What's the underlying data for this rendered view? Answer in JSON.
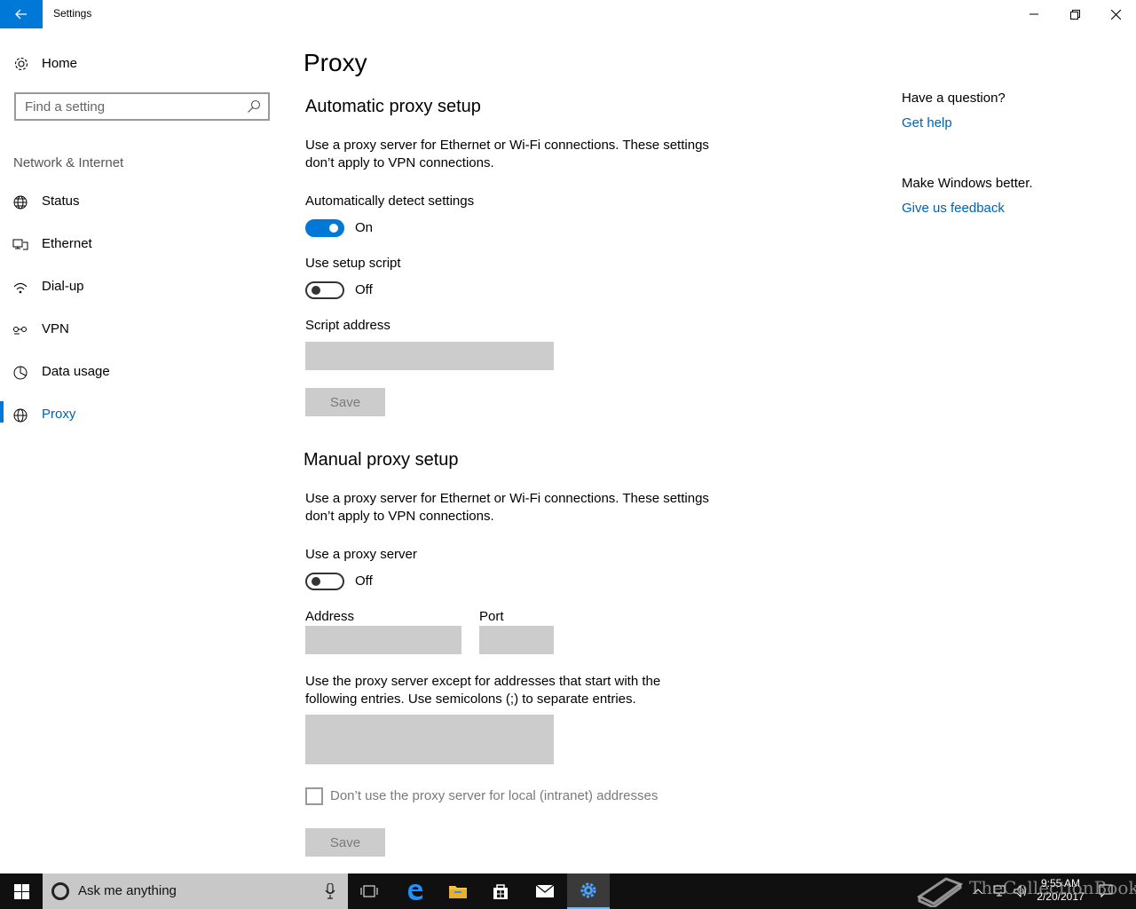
{
  "window": {
    "title": "Settings"
  },
  "sidebar": {
    "home_label": "Home",
    "search_placeholder": "Find a setting",
    "section_title": "Network & Internet",
    "items": [
      {
        "label": "Status",
        "icon": "globe-status-icon"
      },
      {
        "label": "Ethernet",
        "icon": "ethernet-icon"
      },
      {
        "label": "Dial-up",
        "icon": "dialup-icon"
      },
      {
        "label": "VPN",
        "icon": "vpn-icon"
      },
      {
        "label": "Data usage",
        "icon": "data-usage-icon"
      },
      {
        "label": "Proxy",
        "icon": "globe-icon",
        "active": true
      }
    ]
  },
  "main": {
    "page_title": "Proxy",
    "auto": {
      "heading": "Automatic proxy setup",
      "description": "Use a proxy server for Ethernet or Wi-Fi connections. These settings don’t apply to VPN connections.",
      "detect_label": "Automatically detect settings",
      "detect_state": "On",
      "script_label": "Use setup script",
      "script_state": "Off",
      "script_address_label": "Script address",
      "script_address_value": "",
      "save_label": "Save"
    },
    "manual": {
      "heading": "Manual proxy setup",
      "description": "Use a proxy server for Ethernet or Wi-Fi connections. These settings don’t apply to VPN connections.",
      "proxy_label": "Use a proxy server",
      "proxy_state": "Off",
      "address_label": "Address",
      "address_value": "",
      "port_label": "Port",
      "port_value": "",
      "exceptions_description": "Use the proxy server except for addresses that start with the following entries. Use semicolons (;) to separate entries.",
      "exceptions_value": "",
      "local_checkbox_label": "Don’t use the proxy server for local (intranet) addresses",
      "save_label": "Save"
    }
  },
  "right": {
    "question": "Have a question?",
    "help_link": "Get help",
    "feedback_question": "Make Windows better.",
    "feedback_link": "Give us feedback"
  },
  "taskbar": {
    "search_text": "Ask me anything",
    "time": "9:55 AM",
    "date": "2/20/2017",
    "watermark": "TheCollectionBook"
  },
  "colors": {
    "accent": "#0078d7",
    "link": "#0063b1",
    "disabled_field": "#cccccc"
  }
}
